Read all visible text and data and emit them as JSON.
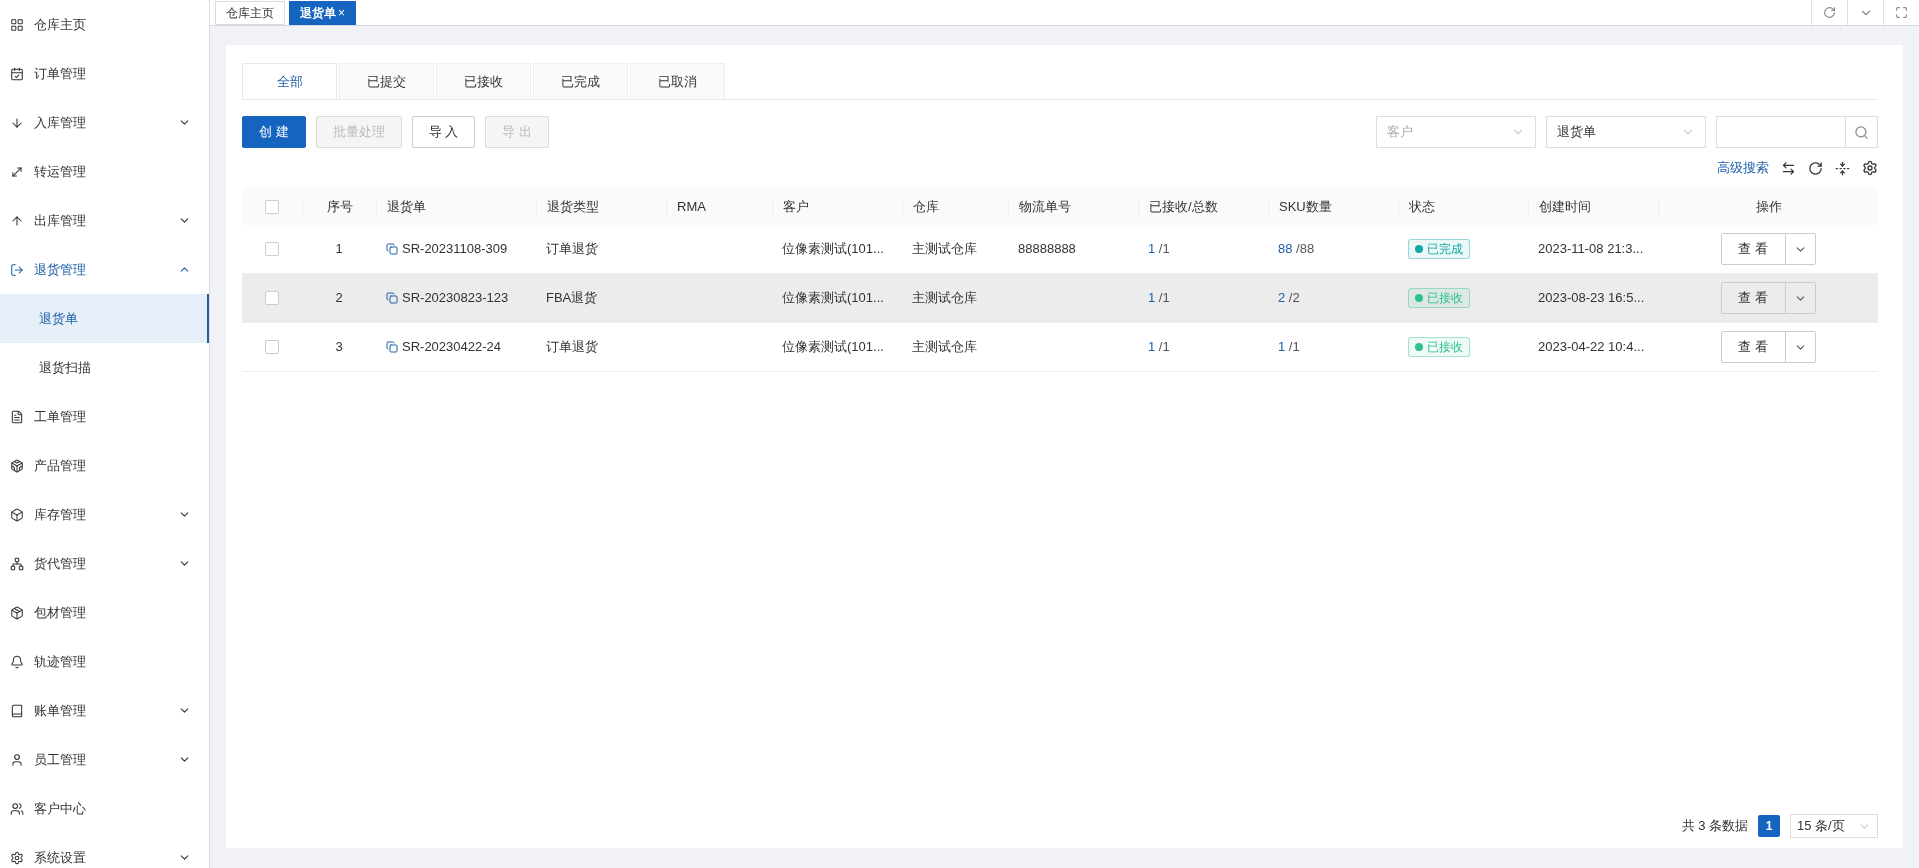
{
  "sidebar": {
    "items": [
      {
        "label": "仓库主页",
        "kind": "link"
      },
      {
        "label": "订单管理",
        "kind": "link"
      },
      {
        "label": "入库管理",
        "kind": "group",
        "expanded": false
      },
      {
        "label": "转运管理",
        "kind": "link"
      },
      {
        "label": "出库管理",
        "kind": "group",
        "expanded": false
      },
      {
        "label": "退货管理",
        "kind": "group",
        "expanded": true,
        "children": [
          {
            "label": "退货单",
            "selected": true
          },
          {
            "label": "退货扫描",
            "selected": false
          }
        ]
      },
      {
        "label": "工单管理",
        "kind": "link"
      },
      {
        "label": "产品管理",
        "kind": "link"
      },
      {
        "label": "库存管理",
        "kind": "group",
        "expanded": false
      },
      {
        "label": "货代管理",
        "kind": "group",
        "expanded": false
      },
      {
        "label": "包材管理",
        "kind": "link"
      },
      {
        "label": "轨迹管理",
        "kind": "link"
      },
      {
        "label": "账单管理",
        "kind": "group",
        "expanded": false
      },
      {
        "label": "员工管理",
        "kind": "group",
        "expanded": false
      },
      {
        "label": "客户中心",
        "kind": "link"
      },
      {
        "label": "系统设置",
        "kind": "group",
        "expanded": false
      }
    ]
  },
  "page_tabs": [
    {
      "label": "仓库主页",
      "selected": false,
      "closable": false
    },
    {
      "label": "退货单",
      "selected": true,
      "closable": true,
      "close": "×"
    }
  ],
  "status_tabs": [
    {
      "label": "全部",
      "selected": true
    },
    {
      "label": "已提交",
      "selected": false
    },
    {
      "label": "已接收",
      "selected": false
    },
    {
      "label": "已完成",
      "selected": false
    },
    {
      "label": "已取消",
      "selected": false
    }
  ],
  "buttons": [
    {
      "label": "创 建",
      "kind": "primary",
      "disabled": false
    },
    {
      "label": "批量处理",
      "kind": "default",
      "disabled": true
    },
    {
      "label": "导 入",
      "kind": "default",
      "disabled": false
    },
    {
      "label": "导 出",
      "kind": "default",
      "disabled": true
    }
  ],
  "filters": {
    "customer": {
      "placeholder": "客户"
    },
    "type": {
      "value": "退货单"
    }
  },
  "advanced_search": "高级搜索",
  "table": {
    "all_checked": false,
    "columns": [
      "序号",
      "退货单",
      "退货类型",
      "RMA",
      "客户",
      "仓库",
      "物流单号",
      "已接收/总数",
      "SKU数量",
      "状态",
      "创建时间",
      "操作"
    ],
    "rows": [
      {
        "checked": false,
        "highlighted": false,
        "index": "1",
        "order": "SR-20231108-309",
        "type": "订单退货",
        "customer": "位像素测试(101...",
        "warehouse": "主测试仓库",
        "tracking": "88888888",
        "received": "1",
        "received_total": "/1",
        "sku": "88",
        "sku_total": "/88",
        "status": {
          "label": "已完成",
          "color": "#13a8a8"
        },
        "created": "2023-11-08 21:3...",
        "action": "查 看"
      },
      {
        "checked": false,
        "highlighted": true,
        "index": "2",
        "order": "SR-20230823-123",
        "type": "FBA退货",
        "customer": "位像素测试(101...",
        "warehouse": "主测试仓库",
        "received": "1",
        "received_total": "/1",
        "sku": "2",
        "sku_total": "/2",
        "status": {
          "label": "已接收",
          "color": "#2fc28c"
        },
        "created": "2023-08-23 16:5...",
        "action": "查 看"
      },
      {
        "checked": false,
        "highlighted": false,
        "index": "3",
        "order": "SR-20230422-24",
        "type": "订单退货",
        "customer": "位像素测试(101...",
        "warehouse": "主测试仓库",
        "received": "1",
        "received_total": "/1",
        "sku": "1",
        "sku_total": "/1",
        "status": {
          "label": "已接收",
          "color": "#2fc28c"
        },
        "created": "2023-04-22 10:4...",
        "action": "查 看"
      }
    ]
  },
  "pagination": {
    "total": "共 3 条数据",
    "pages": [
      {
        "label": "1",
        "selected": true
      }
    ],
    "page_size": "15 条/页"
  }
}
